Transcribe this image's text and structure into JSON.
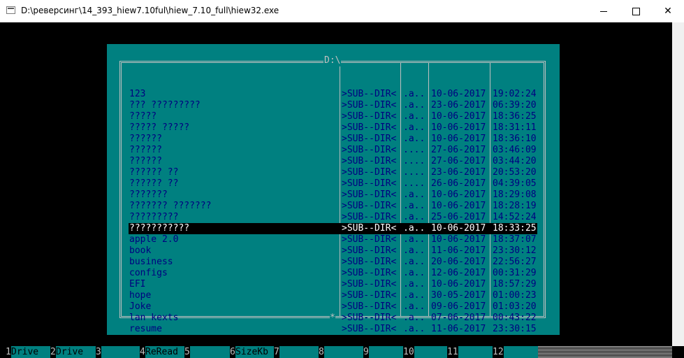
{
  "window": {
    "title": "D:\\реверсинг\\14_393_hiew7.10ful\\hiew_7.10_full\\hiew32.exe",
    "minimize": "–",
    "maximize": "□",
    "close": "✕"
  },
  "panel": {
    "path": "D:\\",
    "bottom_marker": "*"
  },
  "rows": [
    {
      "name": "123",
      "type": ">SUB--DIR<",
      "attr": ".a..",
      "date": "10-06-2017",
      "time": "19:02:24"
    },
    {
      "name": "??? ?????????",
      "type": ">SUB--DIR<",
      "attr": ".a..",
      "date": "23-06-2017",
      "time": "06:39:20"
    },
    {
      "name": "?????",
      "type": ">SUB--DIR<",
      "attr": ".a..",
      "date": "10-06-2017",
      "time": "18:36:25"
    },
    {
      "name": "????? ?????",
      "type": ">SUB--DIR<",
      "attr": ".a..",
      "date": "10-06-2017",
      "time": "18:31:11"
    },
    {
      "name": "??????",
      "type": ">SUB--DIR<",
      "attr": ".a..",
      "date": "10-06-2017",
      "time": "18:36:10"
    },
    {
      "name": "??????",
      "type": ">SUB--DIR<",
      "attr": "....",
      "date": "27-06-2017",
      "time": "03:46:09"
    },
    {
      "name": "??????",
      "type": ">SUB--DIR<",
      "attr": "....",
      "date": "27-06-2017",
      "time": "03:44:20"
    },
    {
      "name": "?????? ??",
      "type": ">SUB--DIR<",
      "attr": "....",
      "date": "23-06-2017",
      "time": "20:53:20"
    },
    {
      "name": "?????? ??",
      "type": ">SUB--DIR<",
      "attr": "....",
      "date": "26-06-2017",
      "time": "04:39:05"
    },
    {
      "name": "???????",
      "type": ">SUB--DIR<",
      "attr": ".a..",
      "date": "10-06-2017",
      "time": "18:29:08"
    },
    {
      "name": "??????? ???????",
      "type": ">SUB--DIR<",
      "attr": ".a..",
      "date": "10-06-2017",
      "time": "18:28:19"
    },
    {
      "name": "?????????",
      "type": ">SUB--DIR<",
      "attr": ".a..",
      "date": "25-06-2017",
      "time": "14:52:24"
    },
    {
      "name": "???????????",
      "type": ">SUB--DIR<",
      "attr": ".a..",
      "date": "10-06-2017",
      "time": "18:33:25",
      "selected": true
    },
    {
      "name": "apple 2.0",
      "type": ">SUB--DIR<",
      "attr": ".a..",
      "date": "10-06-2017",
      "time": "18:37:07"
    },
    {
      "name": "book",
      "type": ">SUB--DIR<",
      "attr": ".a..",
      "date": "11-06-2017",
      "time": "23:30:12"
    },
    {
      "name": "business",
      "type": ">SUB--DIR<",
      "attr": ".a..",
      "date": "20-06-2017",
      "time": "22:56:27"
    },
    {
      "name": "configs",
      "type": ">SUB--DIR<",
      "attr": ".a..",
      "date": "12-06-2017",
      "time": "00:31:29"
    },
    {
      "name": "EFI",
      "type": ">SUB--DIR<",
      "attr": ".a..",
      "date": "10-06-2017",
      "time": "18:57:29"
    },
    {
      "name": "hope",
      "type": ">SUB--DIR<",
      "attr": ".a..",
      "date": "30-05-2017",
      "time": "01:00:23"
    },
    {
      "name": "Joke",
      "type": ">SUB--DIR<",
      "attr": ".a..",
      "date": "09-06-2017",
      "time": "01:03:20"
    },
    {
      "name": "lan kexts",
      "type": ">SUB--DIR<",
      "attr": ".a..",
      "date": "07-06-2017",
      "time": "00:43:22"
    },
    {
      "name": "resume",
      "type": ">SUB--DIR<",
      "attr": ".a..",
      "date": "11-06-2017",
      "time": "23:30:15"
    }
  ],
  "function_keys": [
    {
      "num": "1",
      "label": "Drive"
    },
    {
      "num": "2",
      "label": "Drive"
    },
    {
      "num": "3",
      "label": ""
    },
    {
      "num": "4",
      "label": "ReRead"
    },
    {
      "num": "5",
      "label": ""
    },
    {
      "num": "6",
      "label": "SizeKb"
    },
    {
      "num": "7",
      "label": ""
    },
    {
      "num": "8",
      "label": ""
    },
    {
      "num": "9",
      "label": ""
    },
    {
      "num": "10",
      "label": ""
    },
    {
      "num": "11",
      "label": ""
    },
    {
      "num": "12",
      "label": ""
    }
  ],
  "colors": {
    "panel_bg": "#008080",
    "text": "#000080",
    "selection_bg": "#000000",
    "selection_text": "#ffffff",
    "frame": "#c0c0c0"
  }
}
